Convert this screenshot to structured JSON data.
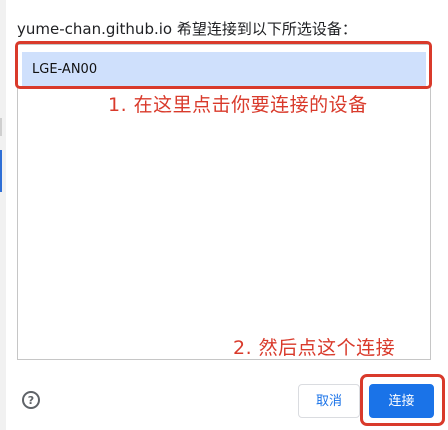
{
  "dialog": {
    "title": "yume-chan.github.io 希望连接到以下所选设备："
  },
  "device_list": {
    "items": [
      {
        "label": "LGE-AN00",
        "selected": true
      }
    ]
  },
  "annotations": {
    "step1": "1. 在这里点击你要连接的设备",
    "step2": "2. 然后点这个连接"
  },
  "buttons": {
    "help_icon": "?",
    "cancel_label": "取消",
    "connect_label": "连接"
  },
  "colors": {
    "selection_bg": "#cfe0fc",
    "primary_button": "#1a73e8",
    "annotation_red": "#d93a2b"
  },
  "icons": {
    "help": "help-circle-icon"
  }
}
